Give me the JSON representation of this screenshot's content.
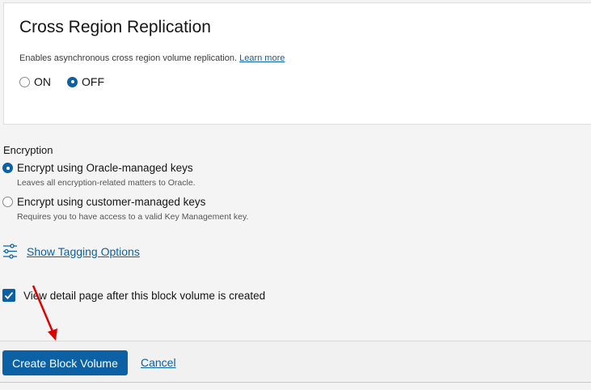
{
  "replication": {
    "title": "Cross Region Replication",
    "description": "Enables asynchronous cross region volume replication.",
    "learn_more": "Learn more",
    "options": [
      {
        "label": "ON",
        "selected": false
      },
      {
        "label": "OFF",
        "selected": true
      }
    ]
  },
  "encryption": {
    "label": "Encryption",
    "options": [
      {
        "label": "Encrypt using Oracle-managed keys",
        "help": "Leaves all encryption-related matters to Oracle.",
        "selected": true
      },
      {
        "label": "Encrypt using customer-managed keys",
        "help": "Requires you to have access to a valid Key Management key.",
        "selected": false
      }
    ]
  },
  "tagging": {
    "link": "Show Tagging Options",
    "icon": "sliders-icon"
  },
  "view_detail": {
    "label": "View detail page after this block volume is created",
    "checked": true
  },
  "footer": {
    "create_label": "Create Block Volume",
    "cancel_label": "Cancel"
  },
  "colors": {
    "accent": "#0b61a4",
    "annotation_arrow": "#e00000"
  }
}
